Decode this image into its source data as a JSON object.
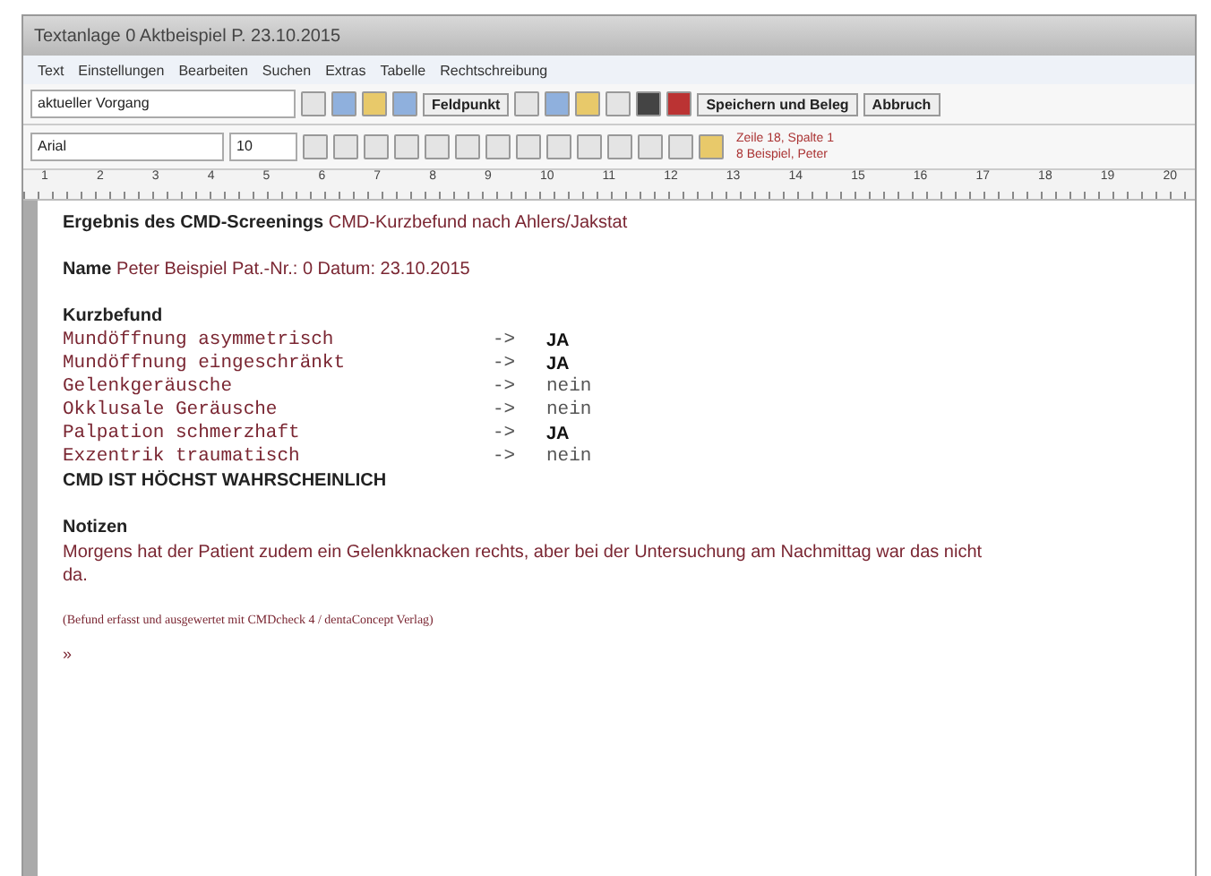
{
  "window": {
    "title": "Textanlage 0 Aktbeispiel P. 23.10.2015"
  },
  "menu": [
    "Text",
    "Einstellungen",
    "Bearbeiten",
    "Suchen",
    "Extras",
    "Tabelle",
    "Rechtschreibung"
  ],
  "toolbar": {
    "process": "aktueller Vorgang",
    "field_button": "Feldpunkt",
    "save_button": "Speichern und Beleg",
    "cancel_button": "Abbruch"
  },
  "format_bar": {
    "font": "Arial",
    "size": "10",
    "position": "Zeile 18, Spalte 1",
    "patient": "8 Beispiel, Peter"
  },
  "ruler": [
    "1",
    "2",
    "3",
    "4",
    "5",
    "6",
    "7",
    "8",
    "9",
    "10",
    "11",
    "12",
    "13",
    "14",
    "15",
    "16",
    "17",
    "18",
    "19",
    "20"
  ],
  "document": {
    "heading_label": "Ergebnis des CMD-Screenings",
    "heading_value": "CMD-Kurzbefund nach Ahlers/Jakstat",
    "name_label": "Name",
    "name_value": "Peter Beispiel Pat.-Nr.: 0 Datum: 23.10.2015",
    "findings_title": "Kurzbefund",
    "findings": [
      {
        "label": "Mundöffnung asymmetrisch",
        "arrow": "->",
        "result": "JA",
        "positive": true
      },
      {
        "label": "Mundöffnung eingeschränkt",
        "arrow": "->",
        "result": "JA",
        "positive": true
      },
      {
        "label": "Gelenkgeräusche",
        "arrow": "->",
        "result": "nein",
        "positive": false
      },
      {
        "label": "Okklusale Geräusche",
        "arrow": "->",
        "result": "nein",
        "positive": false
      },
      {
        "label": "Palpation schmerzhaft",
        "arrow": "->",
        "result": "JA",
        "positive": true
      },
      {
        "label": "Exzentrik traumatisch",
        "arrow": "->",
        "result": "nein",
        "positive": false
      }
    ],
    "conclusion": "CMD IST HÖCHST WAHRSCHEINLICH",
    "notes_title": "Notizen",
    "notes": "Morgens hat der Patient zudem ein Gelenkknacken rechts, aber bei der Untersuchung am Nachmittag war das nicht da.",
    "footer": "(Befund erfasst und ausgewertet mit CMDcheck 4 / dentaConcept Verlag)",
    "cursor": "»"
  }
}
